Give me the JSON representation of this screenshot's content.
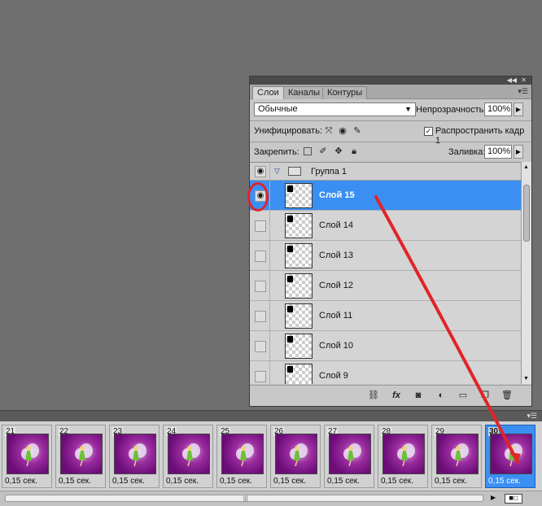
{
  "layers_panel": {
    "tabs": [
      {
        "label": "Слои",
        "active": true
      },
      {
        "label": "Каналы",
        "active": false
      },
      {
        "label": "Контуры",
        "active": false
      }
    ],
    "blend_mode": "Обычные",
    "opacity_label": "Непрозрачность:",
    "opacity_value": "100%",
    "unify_label": "Унифицировать:",
    "propagate_label": "Распространить кадр 1",
    "propagate_checked": true,
    "lock_label": "Закрепить:",
    "fill_label": "Заливка:",
    "fill_value": "100%",
    "group": {
      "name": "Группа 1"
    },
    "layers": [
      {
        "name": "Слой 15",
        "selected": true,
        "visible": true
      },
      {
        "name": "Слой 14",
        "selected": false,
        "visible": false
      },
      {
        "name": "Слой 13",
        "selected": false,
        "visible": false
      },
      {
        "name": "Слой 12",
        "selected": false,
        "visible": false
      },
      {
        "name": "Слой 11",
        "selected": false,
        "visible": false
      },
      {
        "name": "Слой 10",
        "selected": false,
        "visible": false
      },
      {
        "name": "Слой 9",
        "selected": false,
        "visible": false
      }
    ],
    "selection_color": "#3b8ff3"
  },
  "animation": {
    "frames": [
      {
        "number": "21",
        "delay": "0,15 сек."
      },
      {
        "number": "22",
        "delay": "0,15 сек."
      },
      {
        "number": "23",
        "delay": "0,15 сек."
      },
      {
        "number": "24",
        "delay": "0,15 сек."
      },
      {
        "number": "25",
        "delay": "0,15 сек."
      },
      {
        "number": "26",
        "delay": "0,15 сек."
      },
      {
        "number": "27",
        "delay": "0,15 сек."
      },
      {
        "number": "28",
        "delay": "0,15 сек."
      },
      {
        "number": "29",
        "delay": "0,15 сек."
      },
      {
        "number": "30",
        "delay": "0,15 сек.",
        "selected": true
      }
    ]
  },
  "annotation_color": "#e0242a"
}
